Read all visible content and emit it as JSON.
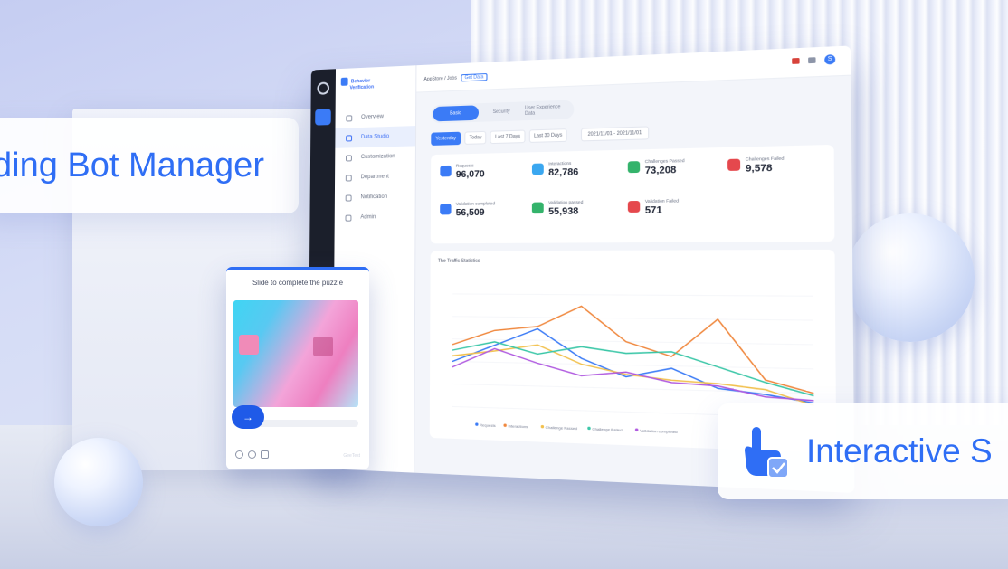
{
  "callouts": {
    "bot_manager": "ding Bot Manager",
    "interactive": "Interactive S"
  },
  "app": {
    "brand_line1": "Behavior",
    "brand_line2": "Verification",
    "breadcrumb": "AppStore / Jobs",
    "crumb_tag": "Get Data"
  },
  "sidebar": {
    "items": [
      {
        "label": "Overview"
      },
      {
        "label": "Data Studio"
      },
      {
        "label": "Customization"
      },
      {
        "label": "Department"
      },
      {
        "label": "Notification"
      },
      {
        "label": "Admin"
      }
    ]
  },
  "tabs": [
    "Basic",
    "Security",
    "User Experience Data"
  ],
  "filters": [
    "Yesterday",
    "Today",
    "Last 7 Days",
    "Last 30 Days"
  ],
  "date_range": {
    "start": "2021/11/01",
    "sep": "-",
    "end": "2021/11/01"
  },
  "stats": [
    {
      "label": "Requests",
      "value": "96,070",
      "color": "#3b7bf6"
    },
    {
      "label": "Interactions",
      "value": "82,786",
      "color": "#3aa7f0"
    },
    {
      "label": "Challenges Passed",
      "value": "73,208",
      "color": "#34b36b"
    },
    {
      "label": "Challenges Failed",
      "value": "9,578",
      "color": "#e5484d"
    },
    {
      "label": "Validation completed",
      "value": "56,509",
      "color": "#3b7bf6"
    },
    {
      "label": "Validation passed",
      "value": "55,938",
      "color": "#34b36b"
    },
    {
      "label": "Validation Failed",
      "value": "571",
      "color": "#e5484d"
    }
  ],
  "chart_title": "The Traffic Statistics",
  "chart_data": {
    "type": "line",
    "x": [
      1,
      2,
      3,
      4,
      5,
      6,
      7,
      8,
      9
    ],
    "series": [
      {
        "name": "Requests",
        "color": "#3b7bf6",
        "values": [
          40,
          55,
          70,
          45,
          30,
          38,
          22,
          18,
          12
        ]
      },
      {
        "name": "Interactions",
        "color": "#f0883e",
        "values": [
          55,
          68,
          72,
          90,
          60,
          48,
          80,
          30,
          20
        ]
      },
      {
        "name": "Challenge Passed",
        "color": "#f2c14e",
        "values": [
          45,
          50,
          56,
          40,
          32,
          28,
          26,
          22,
          10
        ]
      },
      {
        "name": "Challenge Failed",
        "color": "#3cc7a8",
        "values": [
          50,
          58,
          48,
          55,
          50,
          52,
          40,
          28,
          18
        ]
      },
      {
        "name": "Validation completed",
        "color": "#b05ae0",
        "values": [
          35,
          52,
          40,
          30,
          34,
          26,
          24,
          16,
          14
        ]
      }
    ],
    "ylim": [
      0,
      100
    ]
  },
  "captcha": {
    "title": "Slide to complete the puzzle",
    "arrow": "→",
    "brand": "GeeTest"
  }
}
